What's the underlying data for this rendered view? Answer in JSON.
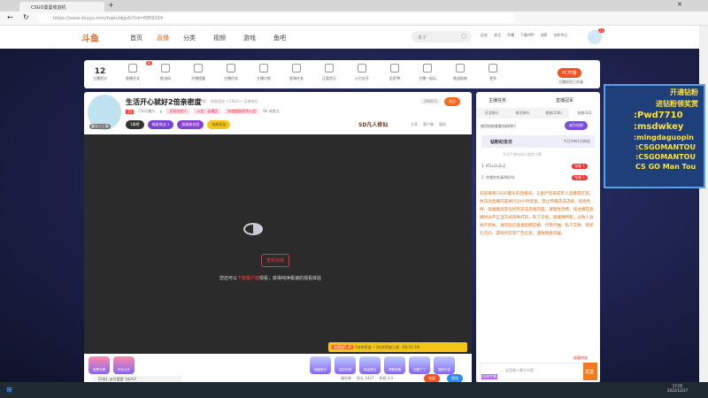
{
  "browser": {
    "tab_title": "CSGO曼曼收割机",
    "url": "https://www.douyu.com/topic/djgzb?rid=6959154"
  },
  "site": {
    "logo": "斗鱼",
    "nav": [
      "首页",
      "直播",
      "分类",
      "视频",
      "游戏",
      "鱼吧"
    ],
    "search_placeholder": "真子",
    "icons": [
      "历史",
      "关注",
      "开播",
      "下载APP",
      "消息",
      "创作中心"
    ],
    "badge": "21"
  },
  "toolbar": {
    "points": "12",
    "points_label": "主播积分",
    "items": [
      "直播开关",
      "推流码",
      "开播提醒",
      "主播任务",
      "主播口袋",
      "星海任务",
      "正版音乐",
      "火力全开",
      "全民PK",
      "主播一起玩",
      "挑战助航",
      "更多"
    ],
    "switch_badge": "8",
    "pc_btn": "PC开播",
    "pc_sub": "主播经验已升级"
  },
  "stream": {
    "title": "生活开心就好2倍亲密度",
    "report": "举报",
    "breadcrumb": "网游竞技 • CSGO • 天梯排位",
    "level": "10",
    "fan_name": "CSGO曼头",
    "hot": "8",
    "tag1": "灵宠创造人",
    "guild": "公会：云曜会",
    "guild_tag": "年度超级优秀公会",
    "viewers": "80 成就点",
    "badges": [
      "1周榜",
      "福星挑战 1",
      "超级粉丝团",
      "钻粉权益"
    ],
    "follow_count": "398025",
    "follow": "关注",
    "brand": "SD凡人修仙",
    "actions": [
      "分享",
      "客户端",
      "福利"
    ],
    "avatar_label": "曼头二三事"
  },
  "video": {
    "retry": "重新加载",
    "msg_prefix": "您还可以",
    "msg_link": "下载客户端",
    "msg_suffix": "观看，获得纯净极速的观看体验"
  },
  "promo": {
    "tag": "亲密度5.4f",
    "text": "2倍亲密度 • 2倍亲密度上限（06:54:18）"
  },
  "gifts": {
    "left": [
      "投票分榜",
      "好友大厅"
    ],
    "right": [
      "超级宝贝",
      "钻石礼物",
      "幸运宝石",
      "荣耀宝箱",
      "天使丁丁",
      "福利礼包"
    ],
    "chat_line": "【2条】@可喜喜飞机A2!",
    "stats": [
      "福利券",
      "鱼丸 5427",
      "鱼翅 3.4"
    ],
    "btn1": "充值",
    "btn2": "背包"
  },
  "sidebar": {
    "top": [
      "主播任务",
      "直播冠军"
    ],
    "tabs": [
      "日活排行",
      "周活排行",
      "贵宾(206)",
      "钻粉(42)"
    ],
    "note": "使用钻粉查看钻粉排行",
    "cta": "成为钻粉",
    "diamond_title": "钻粉纪念日",
    "today": "今日共有1位粉丝",
    "empty": "今天严禁任何人放鱼丁票",
    "rows": [
      {
        "rank": "1",
        "name": "KTLu2u2u2",
        "tag": "钻粉 1"
      },
      {
        "rank": "2",
        "name": "你看你吃真得好吗",
        "tag": "钻粉 1"
      }
    ],
    "notice": "欢迎来到CSGO曼头的直播间。斗鱼严禁未成年人直播或打赏，依法对直播内容进行24小时巡查。禁止传播违法违规、低俗色情、吸烟酗酒等任何有违法违规内容。请理性消费，如主播在直播时以不正当方式诱导打赏，私下交易，请谨慎判断，以防人身财产损失。请勿轻信各类招聘征婚、代练代抽、私下交易、购买礼包码、游戏代充等广告信息，谨防网络诈骗。",
    "block": "屏蔽特效",
    "input_placeholder": "这里输入聊天内容",
    "send": "发送",
    "fan_label": "钻粉专属"
  },
  "overlay": {
    "lines": [
      "开通钻粉",
      "进钻粉领奖赏",
      ":Pwd7710",
      ":msdwkey",
      ":mingdaguopin",
      ":CSGOMANTOU",
      ":CSGOMANTOU",
      "CS GO Man Tou"
    ]
  },
  "taskbar": {
    "time": "17:05",
    "date": "2022/12/27"
  }
}
